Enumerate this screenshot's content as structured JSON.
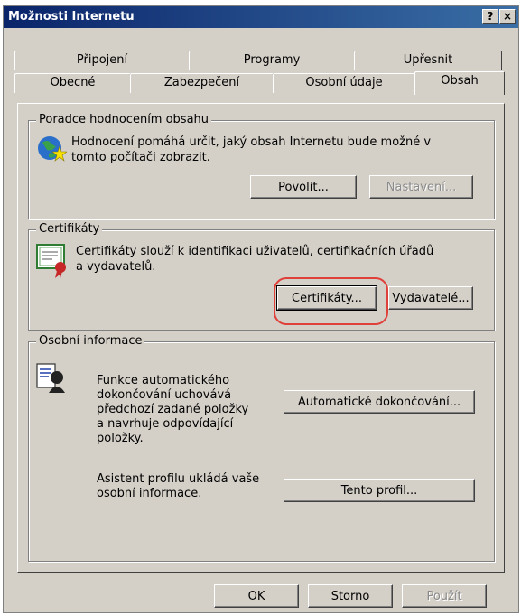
{
  "window": {
    "title": "Možnosti Internetu",
    "help_label": "?",
    "close_label": "×"
  },
  "tabs": {
    "row1": [
      "Připojení",
      "Programy",
      "Upřesnit"
    ],
    "row2": [
      "Obecné",
      "Zabezpečení",
      "Osobní údaje",
      "Obsah"
    ],
    "active": "Obsah"
  },
  "rating": {
    "group_label": "Poradce hodnocením obsahu",
    "description_line1": "Hodnocení pomáhá určit, jaký obsah Internetu bude možné v",
    "description_line2": "tomto počítači zobrazit.",
    "enable_button": "Povolit...",
    "settings_button": "Nastavení..."
  },
  "certificates": {
    "group_label": "Certifikáty",
    "description_line1": "Certifikáty slouží k identifikaci uživatelů, certifikačních úřadů",
    "description_line2": "a vydavatelů.",
    "certificates_button": "Certifikáty...",
    "publishers_button": "Vydavatelé..."
  },
  "personal": {
    "group_label": "Osobní informace",
    "autocomplete_line1": "Funkce automatického",
    "autocomplete_line2": "dokončování uchovává",
    "autocomplete_line3": "předchozí zadané položky",
    "autocomplete_line4": "a navrhuje odpovídající",
    "autocomplete_line5": "položky.",
    "autocomplete_button": "Automatické dokončování...",
    "profile_line1": "Asistent profilu ukládá vaše",
    "profile_line2": "osobní informace.",
    "profile_button": "Tento profil..."
  },
  "footer": {
    "ok": "OK",
    "cancel": "Storno",
    "apply": "Použít"
  },
  "colors": {
    "titlebar_start": "#0a246a",
    "titlebar_end": "#3a6ea5",
    "face": "#d4d0c8",
    "highlight_ring": "#e0403a"
  }
}
